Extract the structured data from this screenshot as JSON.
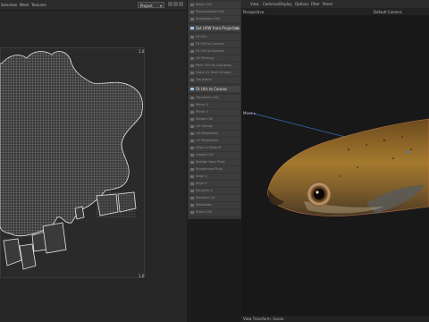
{
  "uv_editor": {
    "menu": [
      "Selection",
      "Mesh",
      "Textures"
    ],
    "view_dropdown": "Project",
    "corner_top_right": "1,0",
    "corner_bottom_right": "1,0"
  },
  "tools": [
    {
      "label": "Relax UVs",
      "hl": false
    },
    {
      "label": "Rectangulate UVs",
      "hl": false
    },
    {
      "label": "Straighten UVs",
      "hl": false
    },
    {
      "label": "Set UVW from Projection",
      "hl": true,
      "gear": true
    },
    {
      "label": "Fit UVs",
      "hl": false
    },
    {
      "label": "Fit UVs to Canvas",
      "hl": false
    },
    {
      "label": "Fit UVs to Bounds",
      "hl": false
    },
    {
      "label": "UV Packing",
      "hl": false
    },
    {
      "label": "Pack UVs by Grouping",
      "hl": false
    },
    {
      "label": "Grow UV Shell Groups",
      "hl": false
    },
    {
      "label": "Transform",
      "hl": false
    },
    {
      "label": "Fit UVs to Canvas",
      "hl": true
    },
    {
      "label": "Transform UVs",
      "hl": false
    },
    {
      "label": "Mirror U",
      "hl": false
    },
    {
      "label": "Mirror V",
      "hl": false
    },
    {
      "label": "Rotate CW",
      "hl": false
    },
    {
      "label": "UV Islands",
      "hl": false
    },
    {
      "label": "UV Relaxation",
      "hl": false
    },
    {
      "label": "UV Relaxation",
      "hl": false
    },
    {
      "label": "Align to Default",
      "hl": false
    },
    {
      "label": "Create UVs",
      "hl": false
    },
    {
      "label": "Realign from Pivot",
      "hl": false
    },
    {
      "label": "Randomize Pivot",
      "hl": false
    },
    {
      "label": "Align U",
      "hl": false
    },
    {
      "label": "Align V",
      "hl": false
    },
    {
      "label": "Equalize U",
      "hl": false
    },
    {
      "label": "Equalize UV",
      "hl": false
    },
    {
      "label": "Distribute",
      "hl": false
    },
    {
      "label": "Stack UVs",
      "hl": false
    },
    {
      "label": "Ungroup",
      "hl": false
    },
    {
      "label": "Unstack",
      "hl": false
    }
  ],
  "viewport": {
    "menu": [
      "View",
      "Cameras",
      "Display",
      "Options",
      "Filter",
      "Panel"
    ],
    "perspective_label": "Perspective",
    "camera_label": "Default Camera",
    "move_label": "Move",
    "status": "View Transform: Scene"
  }
}
